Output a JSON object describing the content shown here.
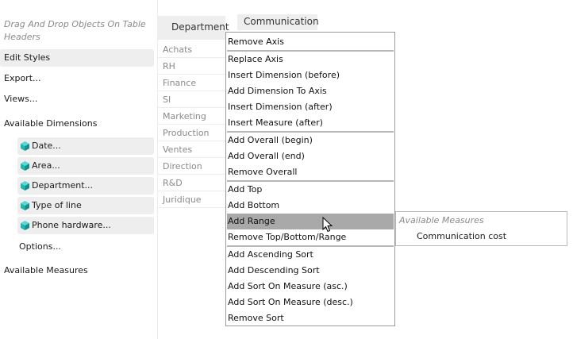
{
  "left_panel": {
    "drag_hint": "Drag And Drop Objects On Table Headers",
    "actions": {
      "edit_styles": "Edit Styles",
      "export": "Export...",
      "views": "Views..."
    },
    "available_dimensions_label": "Available Dimensions",
    "dimensions": [
      "Date...",
      "Area...",
      "Department...",
      "Type of line",
      "Phone hardware..."
    ],
    "options": "Options...",
    "available_measures_label": "Available Measures"
  },
  "table": {
    "row_header": "Department",
    "column_header": "Communication",
    "rows": [
      "Achats",
      "RH",
      "Finance",
      "SI",
      "Marketing",
      "Production",
      "Ventes",
      "Direction",
      "R&D",
      "Juridique"
    ]
  },
  "context_menu": {
    "groups": [
      [
        "Remove Axis"
      ],
      [
        "Replace Axis",
        "Insert Dimension (before)",
        "Add Dimension To Axis",
        "Insert Dimension (after)",
        "Insert Measure (after)"
      ],
      [
        "Add Overall (begin)",
        "Add Overall (end)",
        "Remove Overall"
      ],
      [
        "Add Top",
        "Add Bottom",
        "Add Range",
        "Remove Top/Bottom/Range"
      ],
      [
        "Add Ascending Sort",
        "Add Descending Sort",
        "Add Sort On Measure (asc.)",
        "Add Sort On Measure (desc.)",
        "Remove Sort"
      ]
    ],
    "hovered_item": "Add Range"
  },
  "submenu": {
    "header": "Available Measures",
    "items": [
      "Communication cost"
    ]
  },
  "colors": {
    "cube": "#1fb5b0",
    "hover": "#a9a9a9",
    "panel_bg": "#eeeeee"
  }
}
